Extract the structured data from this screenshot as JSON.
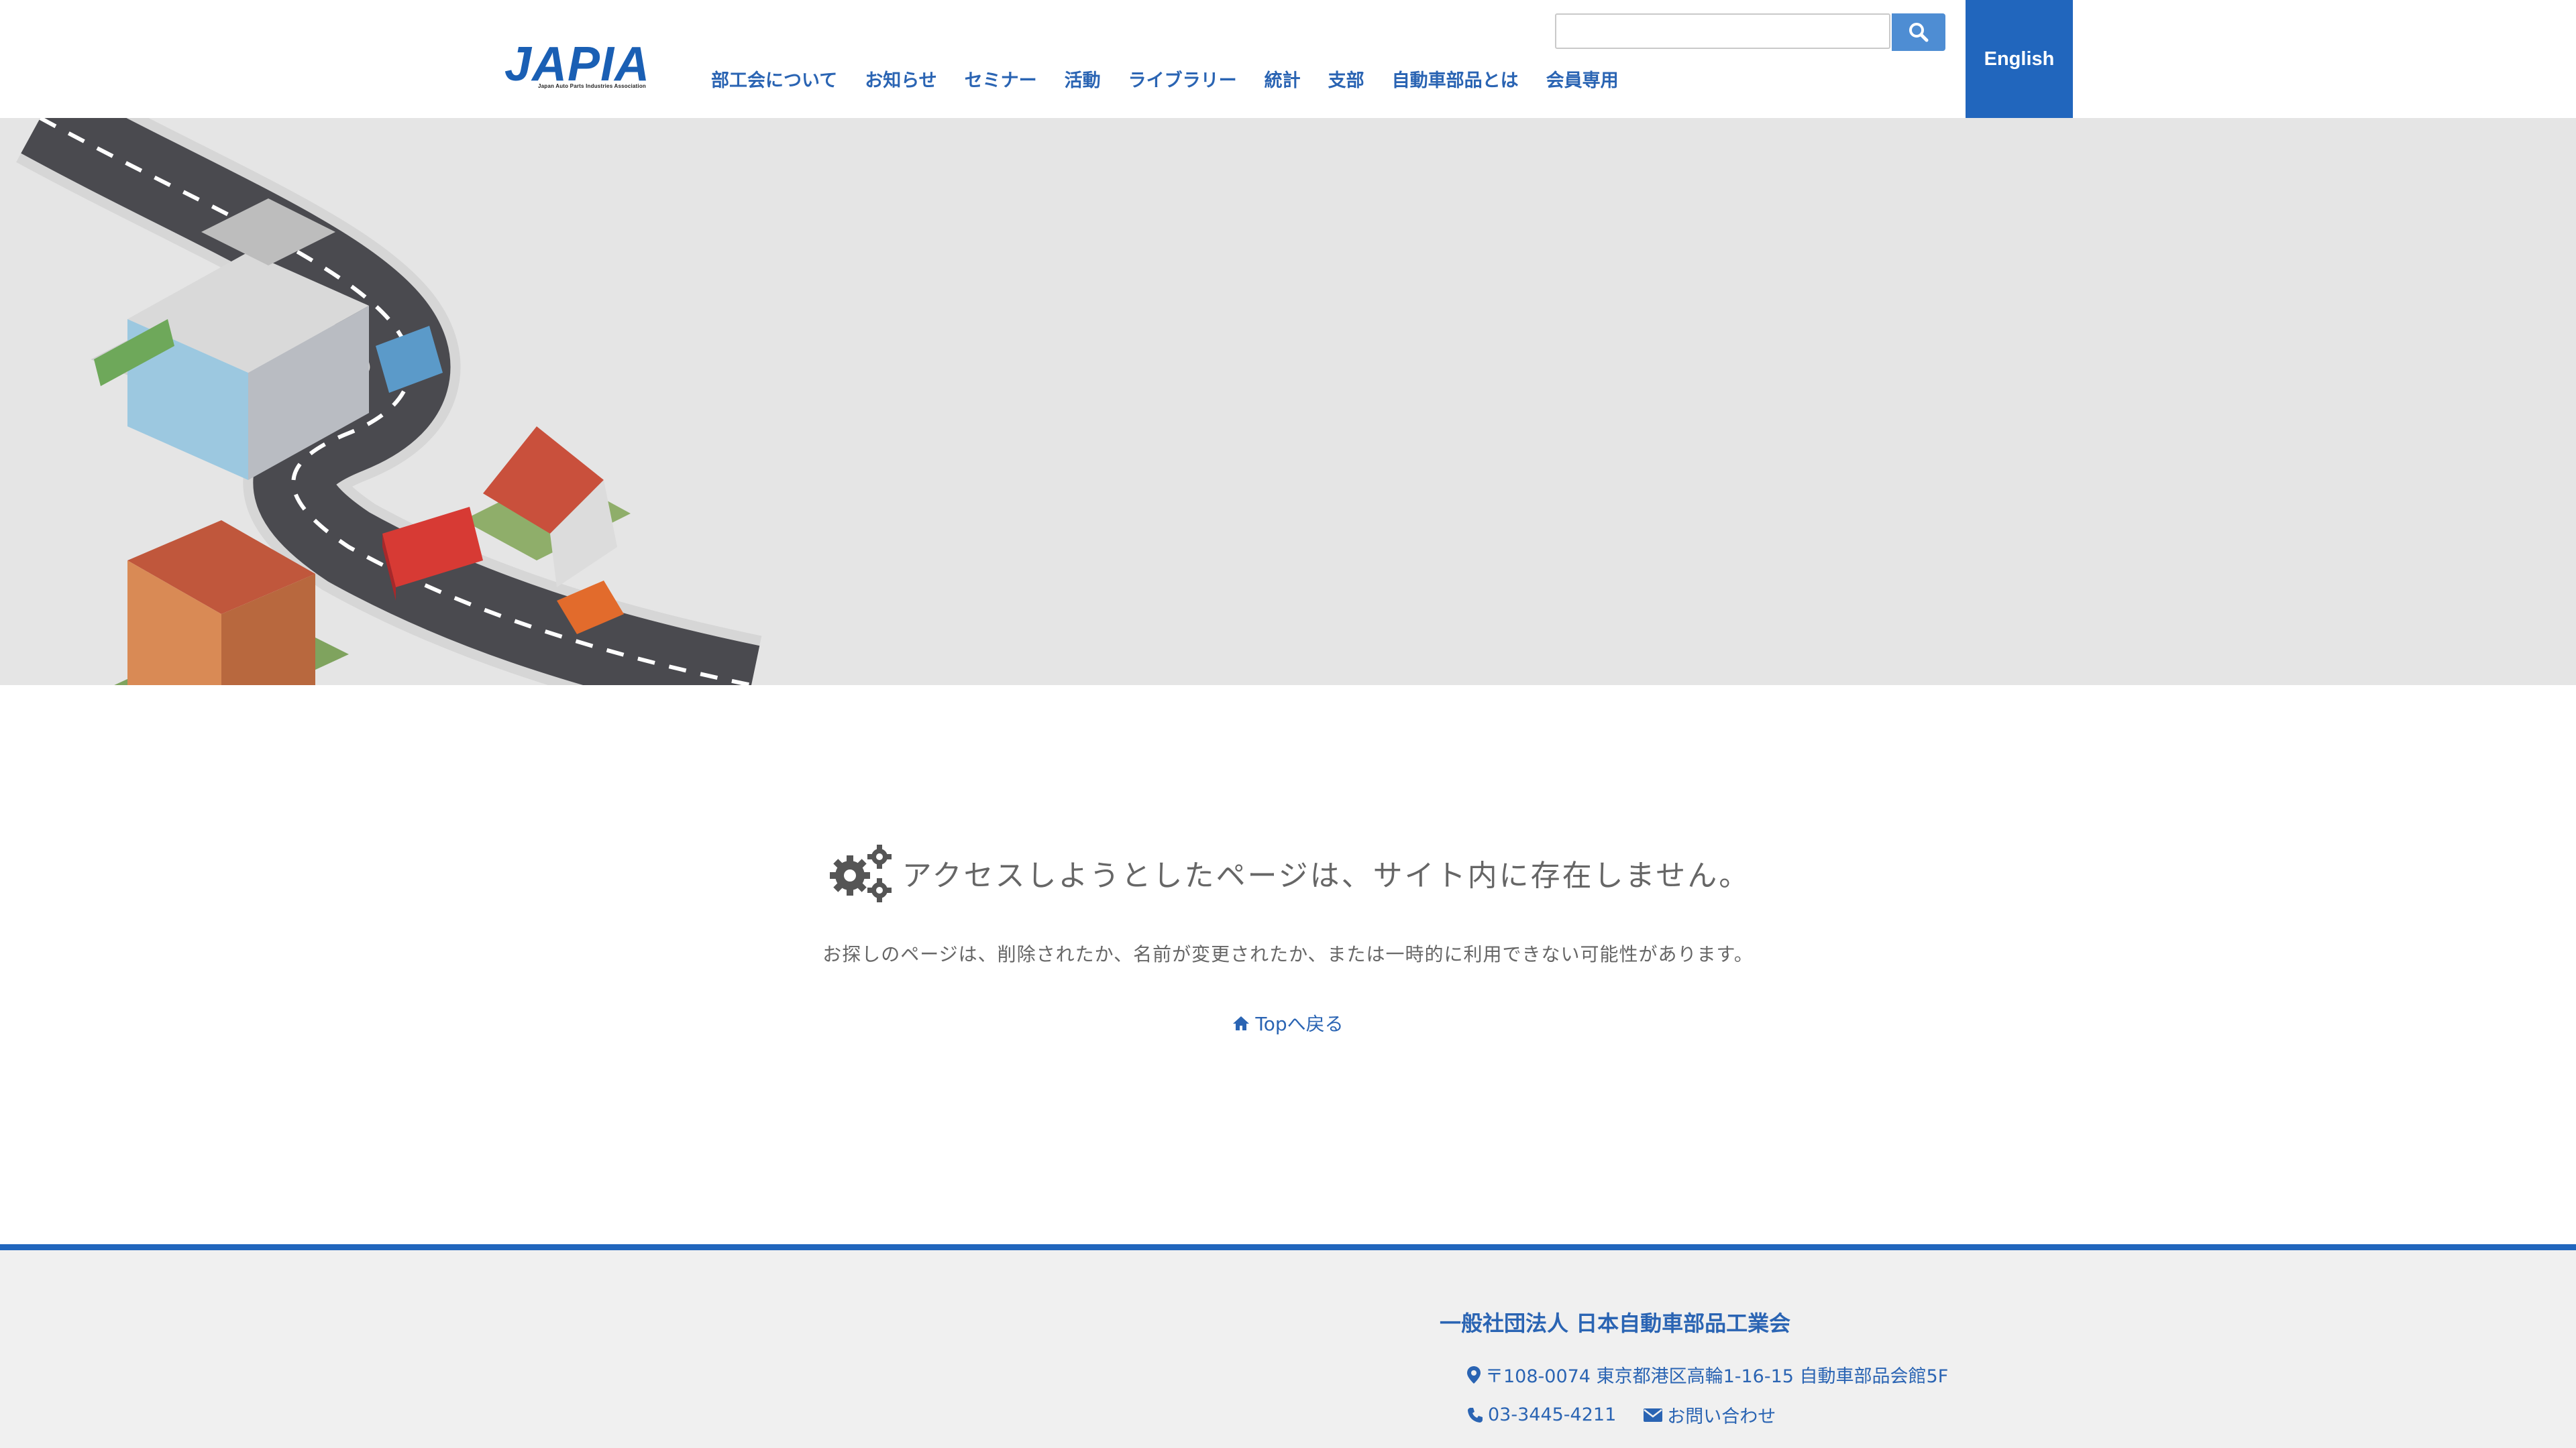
{
  "header": {
    "logo_text": "JAPIA",
    "logo_subtitle": "Japan Auto Parts Industries Association",
    "nav": [
      {
        "label": "部工会について"
      },
      {
        "label": "お知らせ"
      },
      {
        "label": "セミナー"
      },
      {
        "label": "活動"
      },
      {
        "label": "ライブラリー"
      },
      {
        "label": "統計"
      },
      {
        "label": "支部"
      },
      {
        "label": "自動車部品とは"
      },
      {
        "label": "会員専用"
      }
    ],
    "search": {
      "value": "",
      "placeholder": "",
      "icon": "search-icon"
    },
    "language_button": "English"
  },
  "colors": {
    "brand_blue": "#2166bd",
    "link_blue": "#2a64b3",
    "hero_bg": "#e5e5e5",
    "footer_bg": "#f0f0f0"
  },
  "error": {
    "icon": "gears-icon",
    "title": "アクセスしようとしたページは、サイト内に存在しません。",
    "description": "お探しのページは、削除されたか、名前が変更されたか、または一時的に利用できない可能性があります。",
    "back_link": "Topへ戻る"
  },
  "footer": {
    "org_name": "一般社団法人 日本自動車部品工業会",
    "address": "〒108-0074 東京都港区高輪1-16-15 自動車部品会館5F",
    "phone": "03-3445-4211",
    "inquiry": "お問い合わせ"
  }
}
